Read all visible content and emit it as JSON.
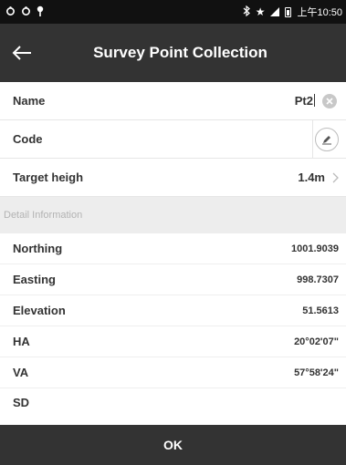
{
  "status_bar": {
    "left_icons": [
      "sync-icon",
      "sync-icon",
      "location-pin-icon"
    ],
    "right_icons": [
      "bluetooth-icon",
      "star-icon",
      "cellular-signal-icon",
      "battery-icon"
    ],
    "time": "上午10:50"
  },
  "app_bar": {
    "title": "Survey Point Collection",
    "back_icon": "back-arrow-icon"
  },
  "form": {
    "name": {
      "label": "Name",
      "value": "Pt2",
      "clear_icon": "clear-icon"
    },
    "code": {
      "label": "Code",
      "value": "",
      "button_icon": "edit-icon"
    },
    "target_height": {
      "label": "Target heigh",
      "value": "1.4m",
      "chevron_icon": "chevron-right-icon"
    }
  },
  "detail": {
    "header": "Detail Information",
    "rows": [
      {
        "label": "Northing",
        "value": "1001.9039"
      },
      {
        "label": "Easting",
        "value": "998.7307"
      },
      {
        "label": "Elevation",
        "value": "51.5613"
      },
      {
        "label": "HA",
        "value": "20°02'07\""
      },
      {
        "label": "VA",
        "value": "57°58'24\""
      }
    ],
    "partial_row_label": "SD"
  },
  "footer": {
    "ok_label": "OK"
  },
  "colors": {
    "status_bar_bg": "#111111",
    "app_bar_bg": "#333333",
    "section_header_bg": "#ededed",
    "text": "#333333"
  }
}
